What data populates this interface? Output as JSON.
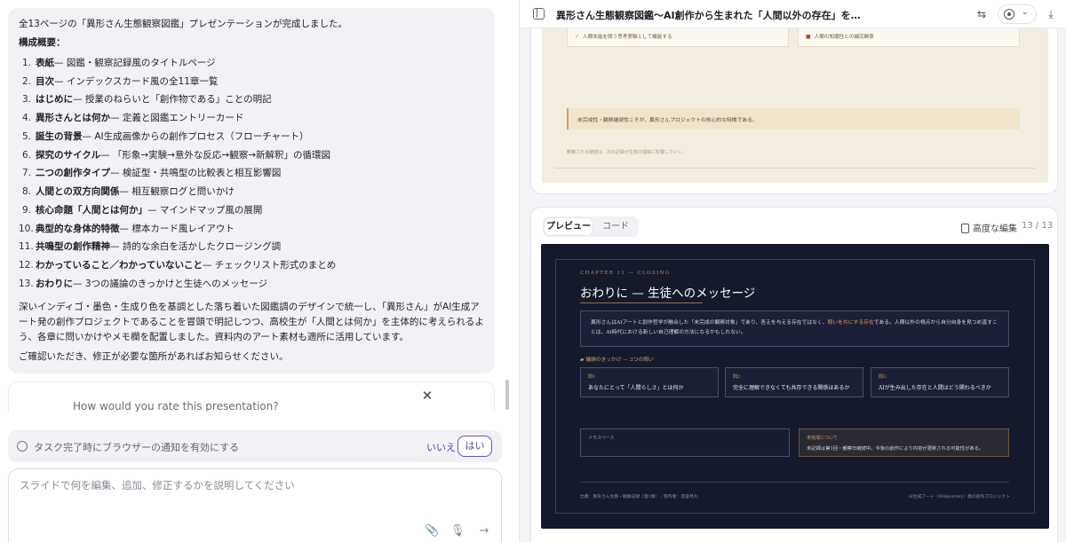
{
  "chat": {
    "intro": "全13ページの「異形さん生態観察図鑑」プレゼンテーションが完成しました。",
    "outline_heading": "構成概要：",
    "outline": [
      {
        "num": "1.",
        "title": "表紙",
        "desc": " — 図鑑・観察記録風のタイトルページ"
      },
      {
        "num": "2.",
        "title": "目次",
        "desc": " — インデックスカード風の全11章一覧"
      },
      {
        "num": "3.",
        "title": "はじめに",
        "desc": " — 授業のねらいと「創作物である」ことの明記"
      },
      {
        "num": "4.",
        "title": "異形さんとは何か",
        "desc": " — 定義と図鑑エントリーカード"
      },
      {
        "num": "5.",
        "title": "誕生の背景",
        "desc": " — AI生成画像からの創作プロセス（フローチャート）"
      },
      {
        "num": "6.",
        "title": "探究のサイクル",
        "desc": " — 「形象→実験→意外な反応→観察→新解釈」の循環図"
      },
      {
        "num": "7.",
        "title": "二つの創作タイプ",
        "desc": " — 検証型・共鳴型の比較表と相互影響図"
      },
      {
        "num": "8.",
        "title": "人間との双方向関係",
        "desc": " — 相互観察ログと問いかけ"
      },
      {
        "num": "9.",
        "title": "核心命題「人間とは何か」",
        "desc": " — マインドマップ風の展開"
      },
      {
        "num": "10.",
        "title": "典型的な身体的特徴",
        "desc": " — 標本カード風レイアウト"
      },
      {
        "num": "11.",
        "title": "共鳴型の創作精神",
        "desc": " — 詩的な余白を活かしたクロージング調"
      },
      {
        "num": "12.",
        "title": "わかっていること／わかっていないこと",
        "desc": " — チェックリスト形式のまとめ"
      },
      {
        "num": "13.",
        "title": "おわりに",
        "desc": " — 3つの議論のきっかけと生徒へのメッセージ"
      }
    ],
    "summary": "深いインディゴ・墨色・生成り色を基調とした落ち着いた図鑑調のデザインで統一し、「異形さん」がAI生成アート発の創作プロジェクトであることを冒頭で明記しつつ、高校生が「人間とは何か」を主体的に考えられるよう、各章に問いかけやメモ欄を配置しました。資料内のアート素材も適所に活用しています。",
    "closing": "ご確認いただき、修正が必要な箇所があればお知らせください。"
  },
  "rating": {
    "question": "How would you rate this presentation?",
    "close": "✕"
  },
  "notify": {
    "label": "タスク完了時にブラウザーの通知を有効にする",
    "no": "いいえ",
    "yes": "はい"
  },
  "composer": {
    "placeholder": "スライドで何を編集、追加、修正するかを説明してください",
    "attach": "📎",
    "mic": "🎙",
    "send": "→"
  },
  "topbar": {
    "title": "異形さん生態観察図鑑〜AI創作から生まれた「人間以外の存在」を通じて「...",
    "share": "⇆",
    "more": "⌄",
    "download": "⤓"
  },
  "slide_prev": {
    "check_left": "✓",
    "check_left_text": "人間本能を問う思考実験として機能する",
    "check_right": "■",
    "check_right_text": "人間の知識性との補完関係",
    "note": "未完成性・観察継続性こそが、異形さんプロジェクトの核心的な特徴である。",
    "foot": "観察される継続は、次の記録が生態の理解に影響していく。"
  },
  "viewer": {
    "tab_preview": "プレビュー",
    "tab_code": "コード",
    "advanced_edit": "高度な編集",
    "pager": "13 / 13"
  },
  "slide": {
    "chapter": "CHAPTER 11 — CLOSING",
    "title": "おわりに — 生徒へのメッセージ",
    "lead_a": "異形さんはAIアートと創作哲学が融合した「未完成の観察対象」であり、答えを与える存在ではなく、",
    "lead_hl": "問いを共にする存在",
    "lead_b": "である。人間以外の視点から自分自身を見つめ直すことは、AI時代における新しい自己理解の方法になるかもしれない。",
    "questions_heading": "議論のきっかけ — 3つの問い",
    "questions": [
      {
        "k": "問1",
        "v": "あなたにとって「人間らしさ」とは何か"
      },
      {
        "k": "問2",
        "v": "完全に理解できなくても共存できる関係はあるか"
      },
      {
        "k": "問3",
        "v": "AIが生み出した存在と人間はどう関わるべきか"
      }
    ],
    "memo": "メモスペース",
    "unfinished_k": "未完成について",
    "unfinished_v": "未記録は第1回・観察日継続中。今後の創作により内容が更新される可能性がある。",
    "footer_left": "出典：異形さん生態・観察記録（第1版）／製作者：変容見丸",
    "footer_right": "AI生成アート（Midjourney）発の創作プロジェクト"
  }
}
